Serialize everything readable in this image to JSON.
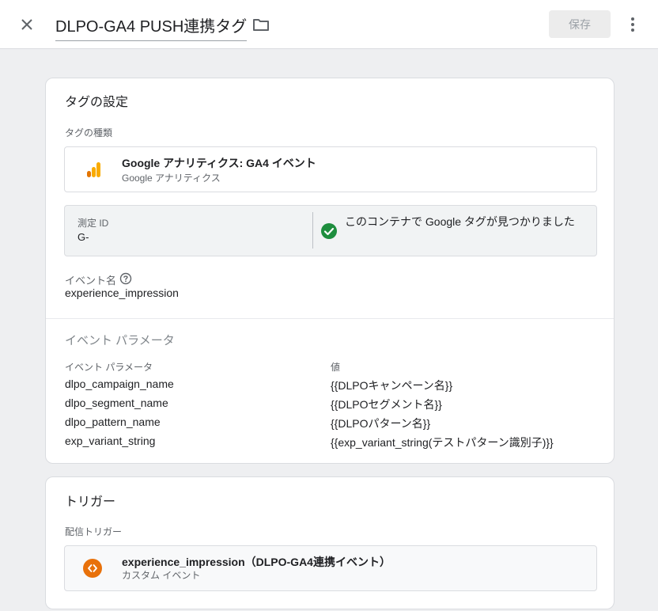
{
  "header": {
    "title": "DLPO-GA4 PUSH連携タグ",
    "save_label": "保存"
  },
  "tag_config": {
    "heading": "タグの設定",
    "type_label": "タグの種類",
    "type_name": "Google アナリティクス: GA4 イベント",
    "type_sub": "Google アナリティクス",
    "measurement_label": "測定 ID",
    "measurement_value": "G-",
    "found_message": "このコンテナで Google タグが見つかりました",
    "event_name_label": "イベント名",
    "event_name_value": "experience_impression",
    "params_section": "イベント パラメータ",
    "params_col_name": "イベント パラメータ",
    "params_col_value": "値",
    "params": [
      {
        "name": "dlpo_campaign_name",
        "value": "{{DLPOキャンペーン名}}"
      },
      {
        "name": "dlpo_segment_name",
        "value": "{{DLPOセグメント名}}"
      },
      {
        "name": "dlpo_pattern_name",
        "value": "{{DLPOパターン名}}"
      },
      {
        "name": "exp_variant_string",
        "value": "{{exp_variant_string(テストパターン識別子)}}"
      }
    ]
  },
  "triggering": {
    "heading": "トリガー",
    "firing_label": "配信トリガー",
    "trigger_name": "experience_impression（DLPO-GA4連携イベント）",
    "trigger_type": "カスタム イベント"
  },
  "icons": {
    "close": "close-icon",
    "folder": "folder-icon",
    "more": "more-vert-icon",
    "analytics": "google-analytics-icon",
    "check": "check-circle-icon",
    "help": "help-icon",
    "trigger": "custom-event-icon"
  },
  "colors": {
    "check_green": "#1e8e3e",
    "trigger_orange": "#e8710a",
    "analytics_orange": "#f9ab00"
  }
}
